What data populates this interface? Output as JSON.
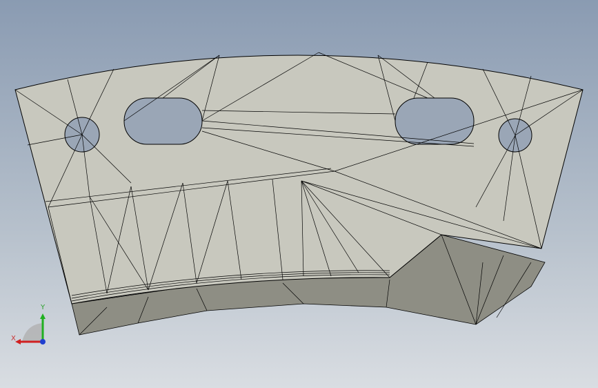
{
  "viewport": {
    "background_top": "#8a9bb2",
    "background_bottom": "#d9dde2"
  },
  "model": {
    "face_color": "#c8c8be",
    "side_color": "#8e8e84",
    "edge_color": "#000000"
  },
  "triad": {
    "x_label": "X",
    "y_label": "Y",
    "x_color": "#d02020",
    "y_color": "#20b020",
    "z_color": "#2040d0"
  }
}
